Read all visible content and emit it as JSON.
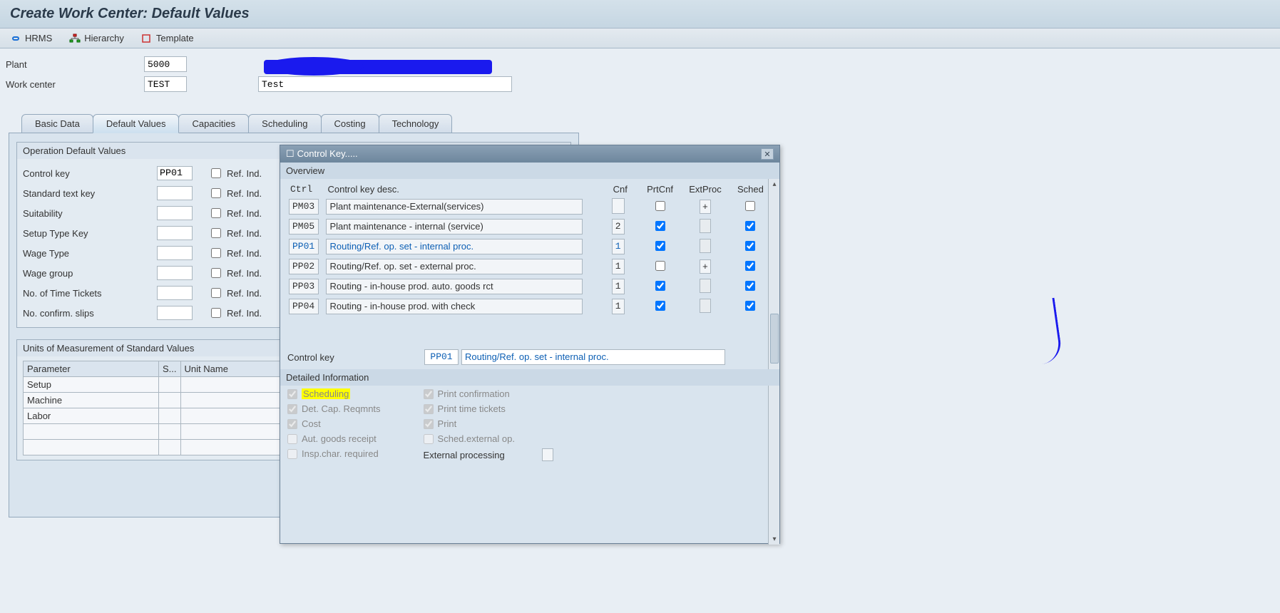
{
  "title": "Create Work Center: Default Values",
  "toolbar": {
    "hrms": "HRMS",
    "hierarchy": "Hierarchy",
    "template": "Template"
  },
  "header": {
    "plant_label": "Plant",
    "plant_value": "5000",
    "wc_label": "Work center",
    "wc_value": "TEST",
    "wc_desc": "Test"
  },
  "tabs": [
    "Basic Data",
    "Default Values",
    "Capacities",
    "Scheduling",
    "Costing",
    "Technology"
  ],
  "active_tab": 1,
  "opdef": {
    "title": "Operation Default Values",
    "rows": [
      {
        "label": "Control key",
        "value": "PP01",
        "ref": "Ref. Ind."
      },
      {
        "label": "Standard text key",
        "value": "",
        "ref": "Ref. Ind."
      },
      {
        "label": "Suitability",
        "value": "",
        "ref": "Ref. Ind."
      },
      {
        "label": "Setup Type Key",
        "value": "",
        "ref": "Ref. Ind."
      },
      {
        "label": "Wage Type",
        "value": "",
        "ref": "Ref. Ind."
      },
      {
        "label": "Wage group",
        "value": "",
        "ref": "Ref. Ind."
      },
      {
        "label": "No. of Time Tickets",
        "value": "",
        "ref": "Ref. Ind."
      },
      {
        "label": "No. confirm. slips",
        "value": "",
        "ref": "Ref. Ind."
      }
    ]
  },
  "uom": {
    "title": "Units of Measurement of Standard Values",
    "cols": [
      "Parameter",
      "S...",
      "Unit Name"
    ],
    "rows": [
      "Setup",
      "Machine",
      "Labor",
      "",
      ""
    ]
  },
  "popup": {
    "title": "Control Key.....",
    "overview_label": "Overview",
    "cols": {
      "ctrl": "Ctrl",
      "desc": "Control key desc.",
      "cnf": "Cnf",
      "prt": "PrtCnf",
      "ext": "ExtProc",
      "sch": "Sched"
    },
    "rows": [
      {
        "ctrl": "PM03",
        "desc": "Plant maintenance-External(services)",
        "cnf": "",
        "prt": false,
        "ext": "+",
        "sch": false,
        "sel": false
      },
      {
        "ctrl": "PM05",
        "desc": "Plant maintenance - internal (service)",
        "cnf": "2",
        "prt": true,
        "ext": "",
        "sch": true,
        "sel": false
      },
      {
        "ctrl": "PP01",
        "desc": "Routing/Ref. op. set - internal proc.",
        "cnf": "1",
        "prt": true,
        "ext": "",
        "sch": true,
        "sel": true
      },
      {
        "ctrl": "PP02",
        "desc": "Routing/Ref. op. set - external proc.",
        "cnf": "1",
        "prt": false,
        "ext": "+",
        "sch": true,
        "sel": false
      },
      {
        "ctrl": "PP03",
        "desc": "Routing - in-house prod. auto. goods rct",
        "cnf": "1",
        "prt": true,
        "ext": "",
        "sch": true,
        "sel": false
      },
      {
        "ctrl": "PP04",
        "desc": "Routing - in-house prod. with check",
        "cnf": "1",
        "prt": true,
        "ext": "",
        "sch": true,
        "sel": false
      }
    ],
    "detail": {
      "key_label": "Control key",
      "key_value": "PP01",
      "key_desc": "Routing/Ref. op. set - internal proc.",
      "info_label": "Detailed Information",
      "left": [
        {
          "label": "Scheduling",
          "chk": true,
          "hl": true
        },
        {
          "label": "Det. Cap. Reqmnts",
          "chk": true
        },
        {
          "label": "Cost",
          "chk": true
        },
        {
          "label": "Aut. goods receipt",
          "chk": false
        },
        {
          "label": "Insp.char. required",
          "chk": false
        }
      ],
      "right": [
        {
          "label": "Print confirmation",
          "chk": true
        },
        {
          "label": "Print time tickets",
          "chk": true
        },
        {
          "label": "Print",
          "chk": true
        },
        {
          "label": "Sched.external op.",
          "chk": false
        },
        {
          "label": "External processing",
          "chk": null,
          "black": true
        }
      ]
    }
  }
}
